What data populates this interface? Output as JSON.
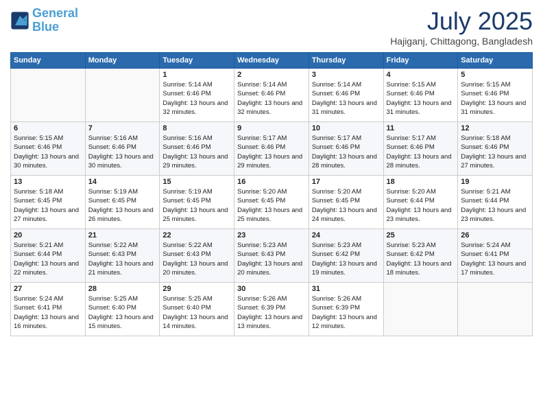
{
  "header": {
    "logo_line1": "General",
    "logo_line2": "Blue",
    "month_title": "July 2025",
    "subtitle": "Hajiganj, Chittagong, Bangladesh"
  },
  "days_of_week": [
    "Sunday",
    "Monday",
    "Tuesday",
    "Wednesday",
    "Thursday",
    "Friday",
    "Saturday"
  ],
  "weeks": [
    [
      {
        "day": "",
        "info": ""
      },
      {
        "day": "",
        "info": ""
      },
      {
        "day": "1",
        "info": "Sunrise: 5:14 AM\nSunset: 6:46 PM\nDaylight: 13 hours and 32 minutes."
      },
      {
        "day": "2",
        "info": "Sunrise: 5:14 AM\nSunset: 6:46 PM\nDaylight: 13 hours and 32 minutes."
      },
      {
        "day": "3",
        "info": "Sunrise: 5:14 AM\nSunset: 6:46 PM\nDaylight: 13 hours and 31 minutes."
      },
      {
        "day": "4",
        "info": "Sunrise: 5:15 AM\nSunset: 6:46 PM\nDaylight: 13 hours and 31 minutes."
      },
      {
        "day": "5",
        "info": "Sunrise: 5:15 AM\nSunset: 6:46 PM\nDaylight: 13 hours and 31 minutes."
      }
    ],
    [
      {
        "day": "6",
        "info": "Sunrise: 5:15 AM\nSunset: 6:46 PM\nDaylight: 13 hours and 30 minutes."
      },
      {
        "day": "7",
        "info": "Sunrise: 5:16 AM\nSunset: 6:46 PM\nDaylight: 13 hours and 30 minutes."
      },
      {
        "day": "8",
        "info": "Sunrise: 5:16 AM\nSunset: 6:46 PM\nDaylight: 13 hours and 29 minutes."
      },
      {
        "day": "9",
        "info": "Sunrise: 5:17 AM\nSunset: 6:46 PM\nDaylight: 13 hours and 29 minutes."
      },
      {
        "day": "10",
        "info": "Sunrise: 5:17 AM\nSunset: 6:46 PM\nDaylight: 13 hours and 28 minutes."
      },
      {
        "day": "11",
        "info": "Sunrise: 5:17 AM\nSunset: 6:46 PM\nDaylight: 13 hours and 28 minutes."
      },
      {
        "day": "12",
        "info": "Sunrise: 5:18 AM\nSunset: 6:46 PM\nDaylight: 13 hours and 27 minutes."
      }
    ],
    [
      {
        "day": "13",
        "info": "Sunrise: 5:18 AM\nSunset: 6:45 PM\nDaylight: 13 hours and 27 minutes."
      },
      {
        "day": "14",
        "info": "Sunrise: 5:19 AM\nSunset: 6:45 PM\nDaylight: 13 hours and 26 minutes."
      },
      {
        "day": "15",
        "info": "Sunrise: 5:19 AM\nSunset: 6:45 PM\nDaylight: 13 hours and 25 minutes."
      },
      {
        "day": "16",
        "info": "Sunrise: 5:20 AM\nSunset: 6:45 PM\nDaylight: 13 hours and 25 minutes."
      },
      {
        "day": "17",
        "info": "Sunrise: 5:20 AM\nSunset: 6:45 PM\nDaylight: 13 hours and 24 minutes."
      },
      {
        "day": "18",
        "info": "Sunrise: 5:20 AM\nSunset: 6:44 PM\nDaylight: 13 hours and 23 minutes."
      },
      {
        "day": "19",
        "info": "Sunrise: 5:21 AM\nSunset: 6:44 PM\nDaylight: 13 hours and 23 minutes."
      }
    ],
    [
      {
        "day": "20",
        "info": "Sunrise: 5:21 AM\nSunset: 6:44 PM\nDaylight: 13 hours and 22 minutes."
      },
      {
        "day": "21",
        "info": "Sunrise: 5:22 AM\nSunset: 6:43 PM\nDaylight: 13 hours and 21 minutes."
      },
      {
        "day": "22",
        "info": "Sunrise: 5:22 AM\nSunset: 6:43 PM\nDaylight: 13 hours and 20 minutes."
      },
      {
        "day": "23",
        "info": "Sunrise: 5:23 AM\nSunset: 6:43 PM\nDaylight: 13 hours and 20 minutes."
      },
      {
        "day": "24",
        "info": "Sunrise: 5:23 AM\nSunset: 6:42 PM\nDaylight: 13 hours and 19 minutes."
      },
      {
        "day": "25",
        "info": "Sunrise: 5:23 AM\nSunset: 6:42 PM\nDaylight: 13 hours and 18 minutes."
      },
      {
        "day": "26",
        "info": "Sunrise: 5:24 AM\nSunset: 6:41 PM\nDaylight: 13 hours and 17 minutes."
      }
    ],
    [
      {
        "day": "27",
        "info": "Sunrise: 5:24 AM\nSunset: 6:41 PM\nDaylight: 13 hours and 16 minutes."
      },
      {
        "day": "28",
        "info": "Sunrise: 5:25 AM\nSunset: 6:40 PM\nDaylight: 13 hours and 15 minutes."
      },
      {
        "day": "29",
        "info": "Sunrise: 5:25 AM\nSunset: 6:40 PM\nDaylight: 13 hours and 14 minutes."
      },
      {
        "day": "30",
        "info": "Sunrise: 5:26 AM\nSunset: 6:39 PM\nDaylight: 13 hours and 13 minutes."
      },
      {
        "day": "31",
        "info": "Sunrise: 5:26 AM\nSunset: 6:39 PM\nDaylight: 13 hours and 12 minutes."
      },
      {
        "day": "",
        "info": ""
      },
      {
        "day": "",
        "info": ""
      }
    ]
  ]
}
